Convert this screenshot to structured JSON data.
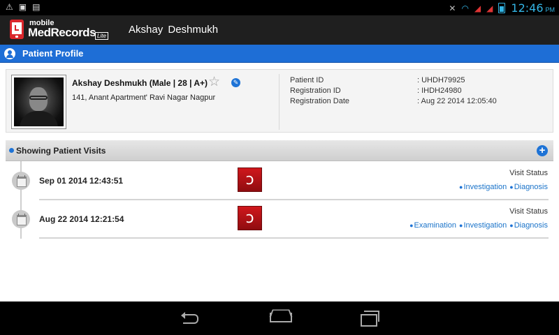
{
  "status_bar": {
    "time": "12:46",
    "ampm": "PM",
    "left_icons": [
      "warning-icon",
      "download-icon",
      "lock-icon"
    ],
    "right_icons": [
      "mute-icon",
      "wifi-icon",
      "signal-icon",
      "signal-icon",
      "battery-icon"
    ]
  },
  "action_bar": {
    "logo_mobile": "mobile",
    "logo_med": "MedRecords",
    "logo_lite": "Lite",
    "title": "Akshay  Deshmukh"
  },
  "profile_bar": {
    "title": "Patient Profile"
  },
  "patient": {
    "name_line": "Akshay  Deshmukh  (Male | 28 | A+)",
    "address": "141, Anant Apartment' Ravi Nagar Nagpur",
    "id_label": "Patient ID",
    "id_value": ": UHDH79925",
    "reg_id_label": "Registration ID",
    "reg_id_value": ": IHDH24980",
    "reg_date_label": "Registration Date",
    "reg_date_value": ": Aug 22 2014 12:05:40"
  },
  "visits": {
    "header": "Showing Patient Visits",
    "status_label": "Visit Status",
    "items": [
      {
        "date": "Sep 01 2014 12:43:51",
        "tags": [
          "Investigation",
          "Diagnosis"
        ]
      },
      {
        "date": "Aug 22 2014 12:21:54",
        "tags": [
          "Examination",
          "Investigation",
          "Diagnosis"
        ]
      }
    ]
  },
  "colors": {
    "accent_blue": "#1e6ed6",
    "status_blue": "#33b5e5",
    "brand_red": "#d9262b",
    "link_blue": "#1a73c9"
  }
}
